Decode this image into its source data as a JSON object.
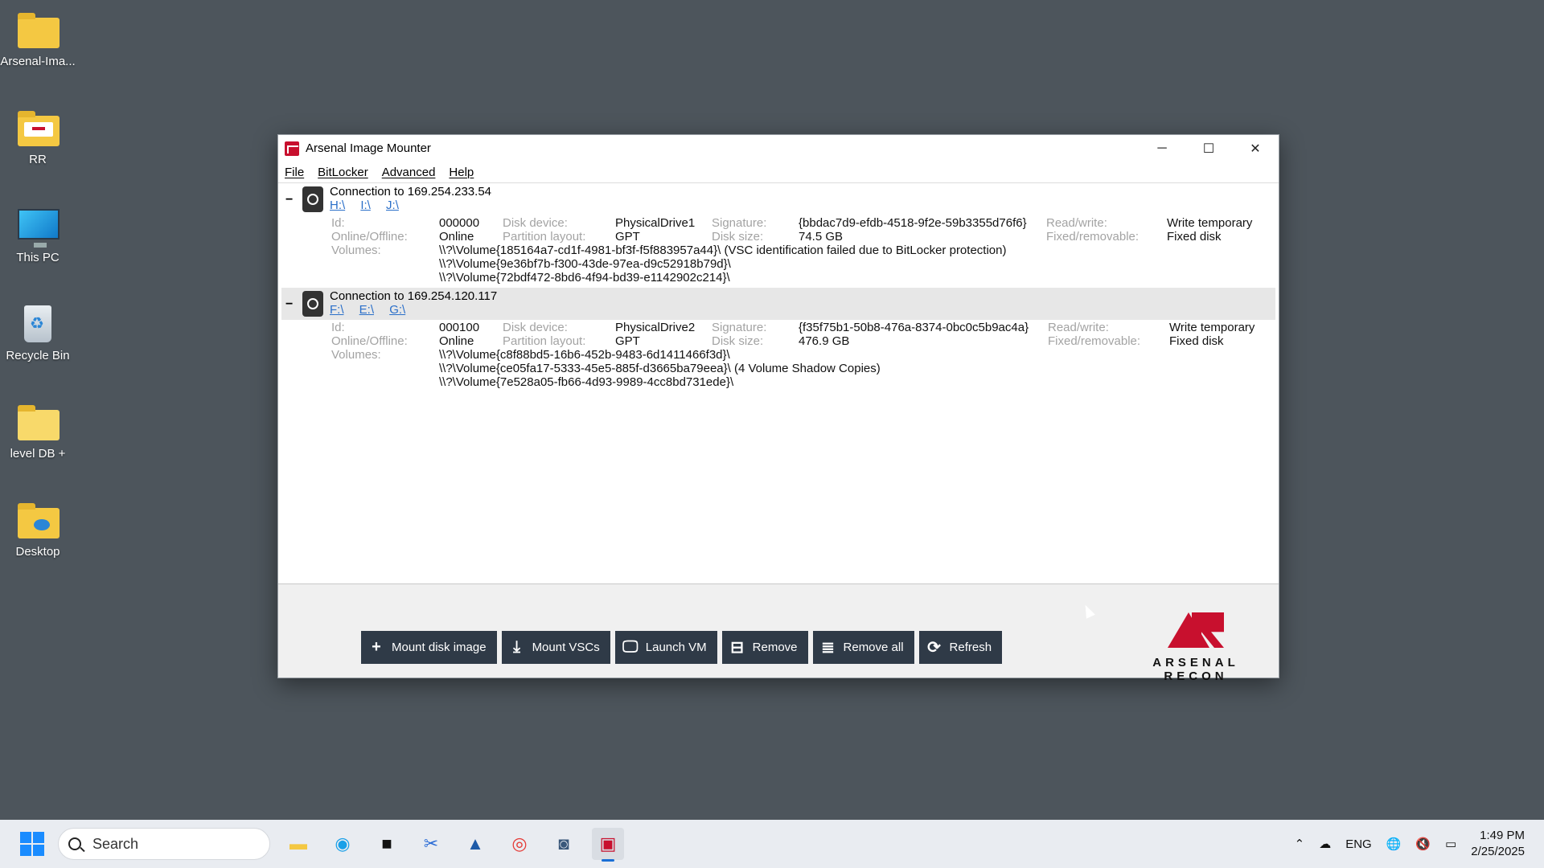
{
  "desktop": {
    "icons": [
      {
        "label": "Arsenal-Ima..."
      },
      {
        "label": "RR"
      },
      {
        "label": "This PC"
      },
      {
        "label": "Recycle Bin"
      },
      {
        "label": "level DB +"
      },
      {
        "label": "Desktop"
      }
    ]
  },
  "window": {
    "title": "Arsenal Image Mounter",
    "controls": {
      "minimize": "─",
      "maximize": "☐",
      "close": "✕"
    },
    "menu": [
      "File",
      "BitLocker",
      "Advanced",
      "Help"
    ]
  },
  "connections": [
    {
      "title": "Connection to 169.254.233.54",
      "drives": [
        "H:\\",
        "I:\\",
        "J:\\"
      ],
      "labels": {
        "id": "Id:",
        "online": "Online/Offline:",
        "volumes": "Volumes:",
        "disk_device": "Disk device:",
        "partition_layout": "Partition layout:",
        "signature": "Signature:",
        "disk_size": "Disk size:",
        "read_write": "Read/write:",
        "fixed_removable": "Fixed/removable:"
      },
      "id": "000000",
      "online": "Online",
      "disk_device": "PhysicalDrive1",
      "partition_layout": "GPT",
      "signature": "{bbdac7d9-efdb-4518-9f2e-59b3355d76f6}",
      "disk_size": "74.5 GB",
      "read_write": "Write temporary",
      "fixed_removable": "Fixed disk",
      "volumes": [
        "\\\\?\\Volume{185164a7-cd1f-4981-bf3f-f5f883957a44}\\ (VSC identification failed due to BitLocker protection)",
        "\\\\?\\Volume{9e36bf7b-f300-43de-97ea-d9c52918b79d}\\",
        "\\\\?\\Volume{72bdf472-8bd6-4f94-bd39-e1142902c214}\\"
      ]
    },
    {
      "title": "Connection to 169.254.120.117",
      "drives": [
        "F:\\",
        "E:\\",
        "G:\\"
      ],
      "labels": {
        "id": "Id:",
        "online": "Online/Offline:",
        "volumes": "Volumes:",
        "disk_device": "Disk device:",
        "partition_layout": "Partition layout:",
        "signature": "Signature:",
        "disk_size": "Disk size:",
        "read_write": "Read/write:",
        "fixed_removable": "Fixed/removable:"
      },
      "id": "000100",
      "online": "Online",
      "disk_device": "PhysicalDrive2",
      "partition_layout": "GPT",
      "signature": "{f35f75b1-50b8-476a-8374-0bc0c5b9ac4a}",
      "disk_size": "476.9 GB",
      "read_write": "Write temporary",
      "fixed_removable": "Fixed disk",
      "volumes": [
        "\\\\?\\Volume{c8f88bd5-16b6-452b-9483-6d1411466f3d}\\",
        "\\\\?\\Volume{ce05fa17-5333-45e5-885f-d3665ba79eea}\\ (4 Volume Shadow Copies)",
        "\\\\?\\Volume{7e528a05-fb66-4d93-9989-4cc8bd731ede}\\"
      ]
    }
  ],
  "buttons": [
    {
      "label": "Mount disk image",
      "icon": "plus-icon"
    },
    {
      "label": "Mount VSCs",
      "icon": "mount-vsc-icon"
    },
    {
      "label": "Launch VM",
      "icon": "vm-icon"
    },
    {
      "label": "Remove",
      "icon": "remove-icon"
    },
    {
      "label": "Remove all",
      "icon": "remove-all-icon"
    },
    {
      "label": "Refresh",
      "icon": "refresh-icon"
    }
  ],
  "logo": {
    "text": "ARSENAL RECON"
  },
  "taskbar": {
    "search_placeholder": "Search",
    "tray": {
      "language": "ENG"
    },
    "clock": {
      "time": "1:49 PM",
      "date": "2/25/2025"
    }
  }
}
